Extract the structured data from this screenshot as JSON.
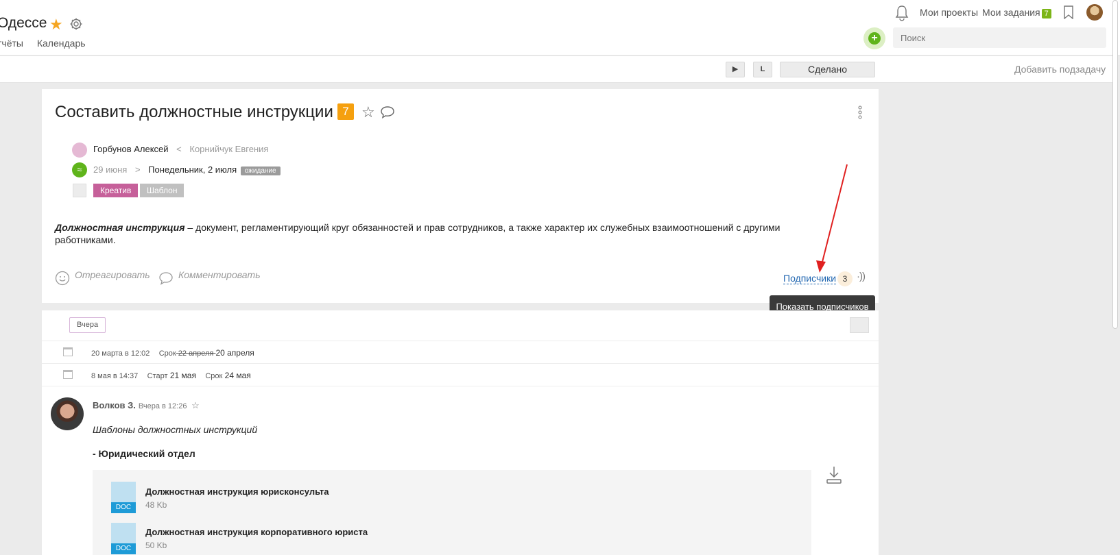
{
  "header": {
    "project_title": "Одессе",
    "tabs": [
      "тчёты",
      "Календарь"
    ],
    "nav": {
      "my_projects": "Мои проекты",
      "my_tasks": "Мои задания",
      "my_tasks_count": "7"
    },
    "add_label": "+",
    "search_placeholder": "Поиск"
  },
  "toolbar": {
    "play_label": "▶",
    "l_label": "L",
    "done_label": "Сделано",
    "add_subtask_label": "Добавить подзадачу"
  },
  "task": {
    "title": "Составить должностные инструкции",
    "comment_count": "7",
    "assignee": "Горбунов Алексей",
    "arrow_left": "<",
    "creator": "Корнийчук Евгения",
    "date_start": "29 июня",
    "arrow_right": ">",
    "date_end": "Понедельник, 2 июля",
    "status": "ожидание",
    "tags": [
      {
        "label": "Креатив",
        "color": "#c6609a"
      },
      {
        "label": "Шаблон",
        "color": "#c0c0c0"
      }
    ],
    "description_bold": "Должностная инструкция",
    "description_rest": " – документ, регламентирующий круг обязанностей и прав сотрудников, а также характер их служебных взаимоотношений с другими работниками.",
    "react_label": "Отреагировать",
    "comment_label": "Комментировать",
    "subscribers_label": "Подписчики",
    "subscribers_count": "3",
    "tooltip": "Показать подписчиков"
  },
  "feed": {
    "day_label": "Вчера",
    "history": [
      {
        "time": "20 марта в 12:02",
        "label1": "Срок",
        "old": " 22 апреля ",
        "new": "20 апреля"
      },
      {
        "time": "8 мая в 14:37",
        "label1": "Старт",
        "val1": "21 мая",
        "label2": "Срок",
        "val2": "24 мая"
      }
    ],
    "comment": {
      "author": "Волков З.",
      "when": "Вчера в 12:26",
      "text": "Шаблоны должностных инструкций",
      "section": "- Юридический отдел",
      "files": [
        {
          "name": "Должностная инструкция юрисконсульта",
          "size": "48 Kb",
          "type": "DOC"
        },
        {
          "name": "Должностная инструкция корпоративного юриста",
          "size": "50 Kb",
          "type": "DOC"
        }
      ]
    }
  },
  "colors": {
    "accent_orange": "#f5a00f",
    "accent_green": "#7cb518",
    "link_blue": "#2066b0",
    "annotation_red": "#e02020"
  }
}
